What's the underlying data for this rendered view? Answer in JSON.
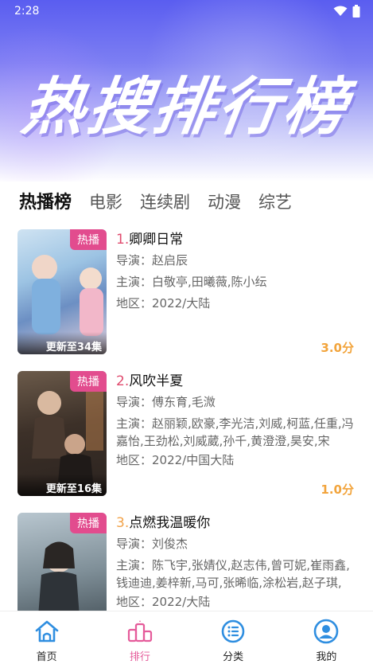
{
  "status_bar": {
    "time": "2:28"
  },
  "hero": {
    "title": "热搜排行榜"
  },
  "tabs": [
    {
      "label": "热播榜",
      "active": true
    },
    {
      "label": "电影",
      "active": false
    },
    {
      "label": "连续剧",
      "active": false
    },
    {
      "label": "动漫",
      "active": false
    },
    {
      "label": "综艺",
      "active": false
    }
  ],
  "items": [
    {
      "rank": "1.",
      "title": "卿卿日常",
      "badge": "热播",
      "update": "更新至34集",
      "director": "导演：赵启辰",
      "cast": "主演：白敬亭,田曦薇,陈小纭",
      "region": "地区：2022/大陆",
      "score": "3.0分"
    },
    {
      "rank": "2.",
      "title": "风吹半夏",
      "badge": "热播",
      "update": "更新至16集",
      "director": "导演：傅东育,毛溦",
      "cast": "主演：赵丽颖,欧豪,李光洁,刘威,柯蓝,任重,冯嘉怡,王劲松,刘威葳,孙千,黄澄澄,昊安,宋",
      "region": "地区：2022/中国大陆",
      "score": "1.0分"
    },
    {
      "rank": "3.",
      "title": "点燃我温暖你",
      "badge": "热播",
      "update": "",
      "director": "导演：刘俊杰",
      "cast": "主演：陈飞宇,张婧仪,赵志伟,曾可妮,崔雨鑫,钱迪迪,姜梓新,马可,张晞临,涂松岩,赵子琪,",
      "region": "地区：2022/大陆",
      "score": ""
    }
  ],
  "bottom_nav": [
    {
      "label": "首页",
      "icon": "home-icon"
    },
    {
      "label": "排行",
      "icon": "ranking-icon"
    },
    {
      "label": "分类",
      "icon": "category-icon"
    },
    {
      "label": "我的",
      "icon": "profile-icon"
    }
  ],
  "colors": {
    "accent": "#e24c8e",
    "score": "#f2a43c",
    "rank1": "#e04b6e",
    "rank3": "#f2a34a",
    "nav_blue": "#2f8ee0"
  }
}
